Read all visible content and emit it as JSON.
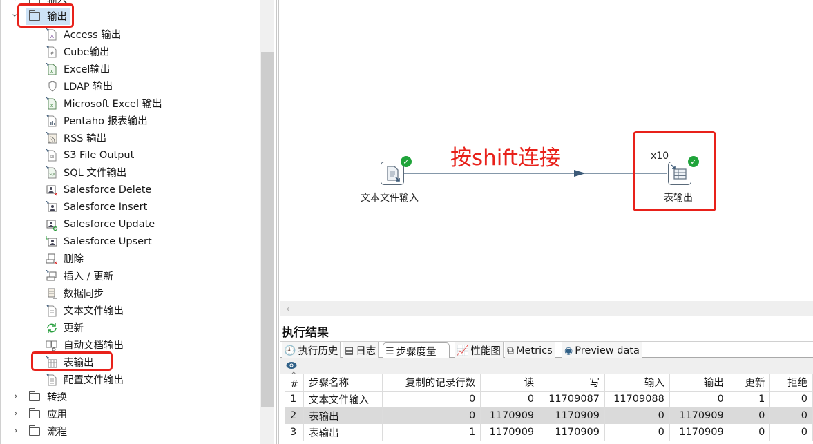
{
  "tree": {
    "partial_top_item": {
      "label": "输入",
      "icon": "folder-icon",
      "expanded": false
    },
    "expanded_folder": {
      "label": "输出",
      "icon": "folder-icon",
      "expanded": true,
      "selected": true,
      "highlighted": true
    },
    "children": [
      {
        "label": "Access 输出",
        "icon": "access-output-icon"
      },
      {
        "label": "Cube输出",
        "icon": "cube-output-icon"
      },
      {
        "label": "Excel输出",
        "icon": "excel-output-icon"
      },
      {
        "label": "LDAP 输出",
        "icon": "ldap-output-icon"
      },
      {
        "label": "Microsoft Excel 输出",
        "icon": "ms-excel-output-icon"
      },
      {
        "label": "Pentaho 报表输出",
        "icon": "pentaho-report-icon"
      },
      {
        "label": "RSS 输出",
        "icon": "rss-output-icon"
      },
      {
        "label": "S3 File Output",
        "icon": "s3-output-icon"
      },
      {
        "label": "SQL 文件输出",
        "icon": "sql-file-output-icon"
      },
      {
        "label": "Salesforce Delete",
        "icon": "salesforce-delete-icon"
      },
      {
        "label": "Salesforce Insert",
        "icon": "salesforce-insert-icon"
      },
      {
        "label": "Salesforce Update",
        "icon": "salesforce-update-icon"
      },
      {
        "label": "Salesforce Upsert",
        "icon": "salesforce-upsert-icon"
      },
      {
        "label": "删除",
        "icon": "delete-icon"
      },
      {
        "label": "插入 / 更新",
        "icon": "insert-update-icon"
      },
      {
        "label": "数据同步",
        "icon": "data-sync-icon"
      },
      {
        "label": "文本文件输出",
        "icon": "text-file-output-icon"
      },
      {
        "label": "更新",
        "icon": "update-icon"
      },
      {
        "label": "自动文档输出",
        "icon": "auto-doc-output-icon"
      },
      {
        "label": "表输出",
        "icon": "table-output-icon",
        "highlighted": true
      },
      {
        "label": "配置文件输出",
        "icon": "properties-output-icon"
      }
    ],
    "collapsed_folders": [
      {
        "label": "转换",
        "icon": "folder-icon"
      },
      {
        "label": "应用",
        "icon": "folder-icon"
      },
      {
        "label": "流程",
        "icon": "folder-icon"
      }
    ]
  },
  "canvas": {
    "annotation": "按shift连接",
    "steps": [
      {
        "name": "文本文件输入",
        "icon": "text-file-input-icon",
        "status": "success"
      },
      {
        "name": "表输出",
        "icon": "table-output-icon",
        "status": "success",
        "copies": "x10",
        "highlighted": true
      }
    ],
    "hop": {
      "from": "文本文件输入",
      "to": "表输出"
    },
    "scroll_left_icon": "chevron-left-icon"
  },
  "results": {
    "title": "执行结果",
    "tabs": [
      {
        "label": "执行历史",
        "icon": "clock-icon",
        "active": false
      },
      {
        "label": "日志",
        "icon": "log-icon",
        "active": false
      },
      {
        "label": "步骤度量",
        "icon": "step-metrics-icon",
        "active": true
      },
      {
        "label": "性能图",
        "icon": "perf-chart-icon",
        "active": false
      },
      {
        "label": "Metrics",
        "icon": "metrics-icon",
        "active": false
      },
      {
        "label": "Preview data",
        "icon": "eye-icon",
        "active": false
      }
    ],
    "toolbar_icon": "eye-icon",
    "table": {
      "columns": [
        "#",
        "步骤名称",
        "复制的记录行数",
        "读",
        "写",
        "输入",
        "输出",
        "更新",
        "拒绝"
      ],
      "sort_indicator": "^",
      "rows": [
        {
          "n": "1",
          "name": "文本文件输入",
          "copy": "0",
          "read": "0",
          "written": "11709087",
          "input": "11709088",
          "output": "0",
          "updated": "1",
          "rejected": "0",
          "selected": false
        },
        {
          "n": "2",
          "name": "表输出",
          "copy": "0",
          "read": "1170909",
          "written": "1170909",
          "input": "0",
          "output": "1170909",
          "updated": "0",
          "rejected": "0",
          "selected": true
        },
        {
          "n": "3",
          "name": "表输出",
          "copy": "1",
          "read": "1170909",
          "written": "1170909",
          "input": "0",
          "output": "1170909",
          "updated": "0",
          "rejected": "0",
          "selected": false
        }
      ]
    }
  },
  "colors": {
    "annotation_red": "#e8211a",
    "success_green": "#1fa43a",
    "hop_line": "#3c5a78",
    "selected_row": "#dadada",
    "selected_tree": "#cde2f6"
  }
}
